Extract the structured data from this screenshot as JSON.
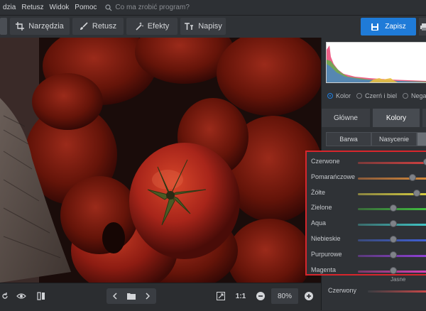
{
  "menu": {
    "items": [
      "dzia",
      "Retusz",
      "Widok",
      "Pomoc"
    ],
    "search_placeholder": "Co ma zrobić program?"
  },
  "toolbar": {
    "tools": [
      {
        "label": "Narzędzia",
        "icon": "crop-icon"
      },
      {
        "label": "Retusz",
        "icon": "brush-icon"
      },
      {
        "label": "Efekty",
        "icon": "magic-wand-icon"
      },
      {
        "label": "Napisy",
        "icon": "text-icon"
      }
    ],
    "save_label": "Zapisz"
  },
  "bottombar": {
    "ratio_label": "1:1",
    "zoom_value": "80%"
  },
  "panel": {
    "radios": [
      {
        "label": "Kolor",
        "selected": true
      },
      {
        "label": "Czerń i biel",
        "selected": false
      },
      {
        "label": "Negaty",
        "selected": false
      }
    ],
    "tabs_main": [
      {
        "label": "Główne",
        "active": false
      },
      {
        "label": "Kolory",
        "active": true
      }
    ],
    "tabs_sub": [
      {
        "label": "Barwa"
      },
      {
        "label": "Nasycenie"
      }
    ],
    "sliders": [
      {
        "label": "Czerwone",
        "value": 0.97,
        "colors": [
          "#7a3a3a",
          "#d04040"
        ]
      },
      {
        "label": "Pomarańczowe",
        "value": 0.77,
        "colors": [
          "#8a5a3a",
          "#d58a3a"
        ]
      },
      {
        "label": "Żółte",
        "value": 0.83,
        "colors": [
          "#8a8440",
          "#d8cf40"
        ]
      },
      {
        "label": "Zielone",
        "value": 0.5,
        "colors": [
          "#3a6a3a",
          "#40c040"
        ]
      },
      {
        "label": "Aqua",
        "value": 0.5,
        "colors": [
          "#3a6a6a",
          "#40c8c8"
        ]
      },
      {
        "label": "Niebieskie",
        "value": 0.5,
        "colors": [
          "#3a4a7a",
          "#4060d8"
        ]
      },
      {
        "label": "Purpurowe",
        "value": 0.5,
        "colors": [
          "#5a3a7a",
          "#9040d8"
        ]
      },
      {
        "label": "Magenta",
        "value": 0.5,
        "colors": [
          "#7a3a6a",
          "#d840b8"
        ]
      }
    ],
    "jasne_label": "Jasne",
    "czerwony": {
      "label": "Czerwony",
      "value": 0.98
    }
  }
}
